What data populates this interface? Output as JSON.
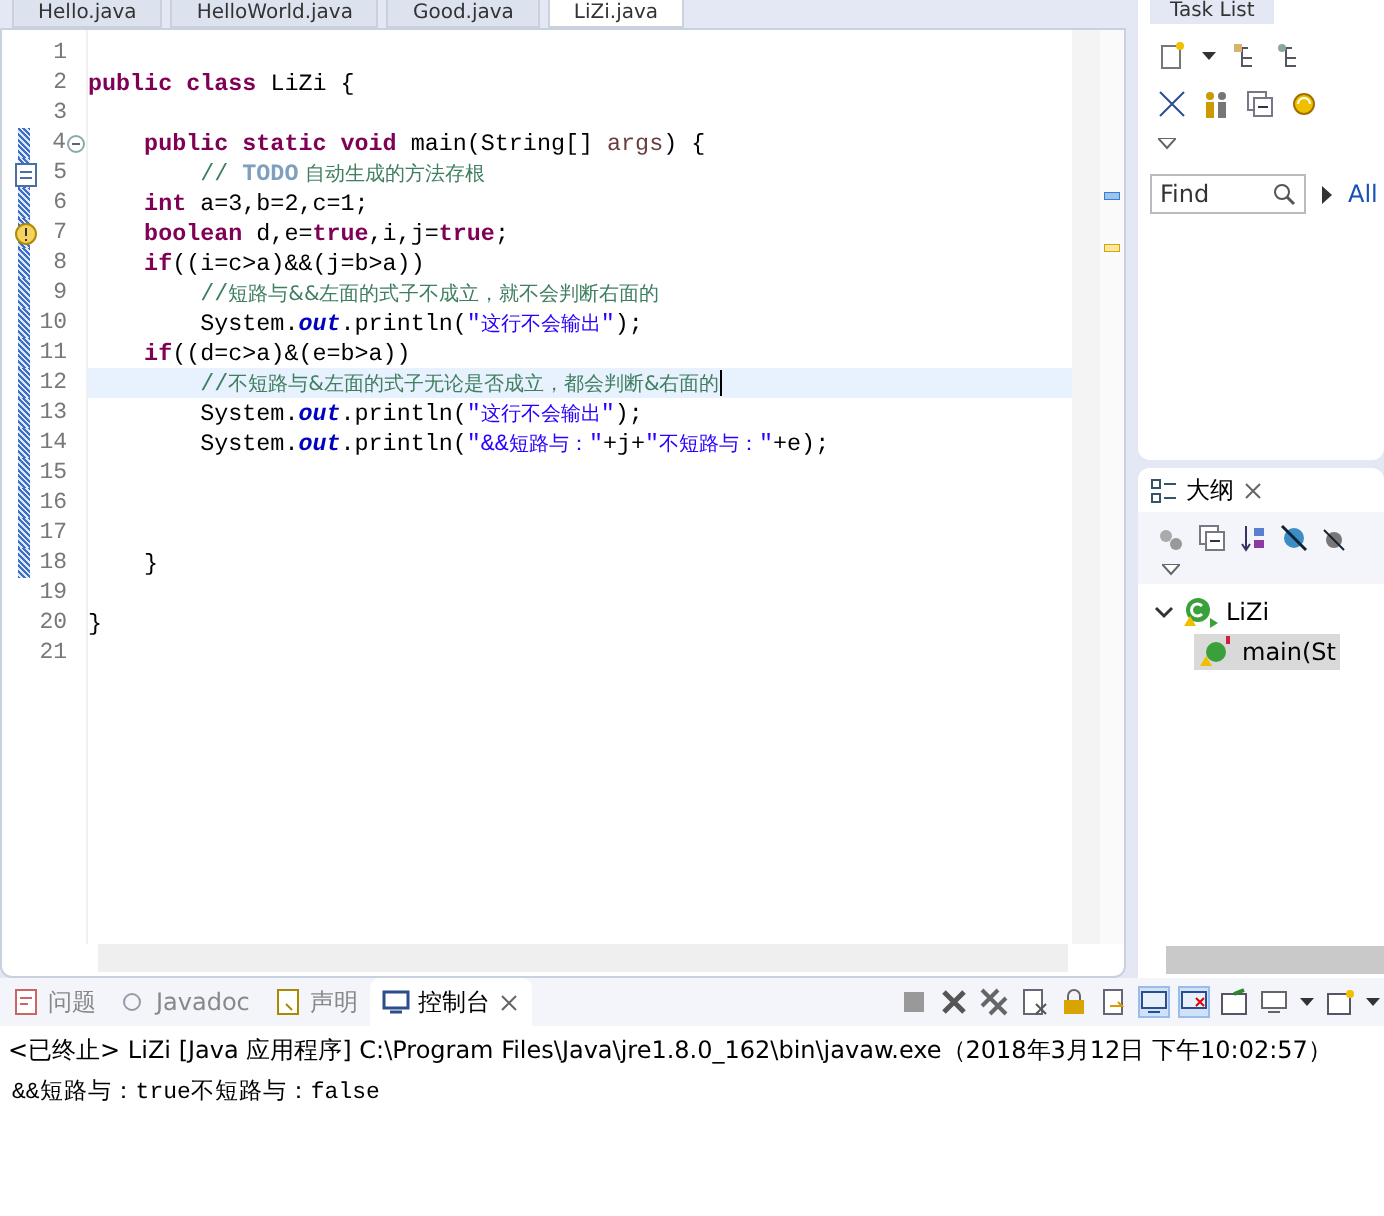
{
  "editor_tabs": [
    {
      "label": "Hello.java",
      "selected": false
    },
    {
      "label": "HelloWorld.java",
      "selected": false
    },
    {
      "label": "Good.java",
      "selected": false
    },
    {
      "label": "LiZi.java",
      "selected": true
    }
  ],
  "code_lines": [
    {
      "number": "1",
      "kind": "plain",
      "current": false,
      "changed": false
    },
    {
      "number": "2",
      "kind": "plain",
      "current": false,
      "changed": false,
      "tokens": [
        {
          "kind": "keyword",
          "text": "public class "
        },
        {
          "kind": "plain",
          "text": "LiZi {"
        }
      ]
    },
    {
      "number": "3",
      "kind": "plain",
      "current": false,
      "changed": false
    },
    {
      "number": "4",
      "kind": "fold",
      "current": false,
      "changed": true,
      "tokens": [
        {
          "kind": "keyword",
          "text": "    public static void "
        },
        {
          "kind": "plain",
          "text": "main(String[] "
        },
        {
          "kind": "variable",
          "text": "args"
        },
        {
          "kind": "plain",
          "text": ") {"
        }
      ]
    },
    {
      "number": "5",
      "kind": "task",
      "current": false,
      "changed": true,
      "tokens": [
        {
          "kind": "comment",
          "text": "        // "
        },
        {
          "kind": "todo",
          "text": "TODO"
        },
        {
          "kind": "comment_cjk",
          "text": " 自动生成的方法存根"
        }
      ]
    },
    {
      "number": "6",
      "kind": "plain",
      "current": false,
      "changed": true,
      "tokens": [
        {
          "kind": "keyword",
          "text": "    int "
        },
        {
          "kind": "plain",
          "text": "a=3,b=2,c=1;"
        }
      ]
    },
    {
      "number": "7",
      "kind": "warning",
      "current": false,
      "changed": true,
      "tokens": [
        {
          "kind": "keyword",
          "text": "    boolean "
        },
        {
          "kind": "plain",
          "text": "d,e="
        },
        {
          "kind": "keyword",
          "text": "true"
        },
        {
          "kind": "plain",
          "text": ",i,j="
        },
        {
          "kind": "keyword",
          "text": "true"
        },
        {
          "kind": "plain",
          "text": ";"
        }
      ]
    },
    {
      "number": "8",
      "kind": "plain",
      "current": false,
      "changed": true,
      "tokens": [
        {
          "kind": "keyword",
          "text": "    if"
        },
        {
          "kind": "plain",
          "text": "((i=c>a)&&(j=b>a))"
        }
      ]
    },
    {
      "number": "9",
      "kind": "plain",
      "current": false,
      "changed": true,
      "tokens": [
        {
          "kind": "comment",
          "text": "        //"
        },
        {
          "kind": "comment_cjk",
          "text": "短路与&&左面的式子不成立，就不会判断右面的"
        }
      ]
    },
    {
      "number": "10",
      "kind": "plain",
      "current": false,
      "changed": true,
      "tokens": [
        {
          "kind": "plain",
          "text": "        System."
        },
        {
          "kind": "field",
          "text": "out"
        },
        {
          "kind": "plain",
          "text": ".println("
        },
        {
          "kind": "string",
          "text": "\""
        },
        {
          "kind": "string_cjk",
          "text": "这行不会输出"
        },
        {
          "kind": "string",
          "text": "\""
        },
        {
          "kind": "plain",
          "text": ");"
        }
      ]
    },
    {
      "number": "11",
      "kind": "plain",
      "current": false,
      "changed": true,
      "tokens": [
        {
          "kind": "keyword",
          "text": "    if"
        },
        {
          "kind": "plain",
          "text": "((d=c>a)&(e=b>a))"
        }
      ]
    },
    {
      "number": "12",
      "kind": "plain",
      "current": true,
      "changed": true,
      "tokens": [
        {
          "kind": "comment",
          "text": "        //"
        },
        {
          "kind": "comment_cjk",
          "text": "不短路与&左面的式子无论是否成立，都会判断&右面的"
        }
      ]
    },
    {
      "number": "13",
      "kind": "plain",
      "current": false,
      "changed": true,
      "tokens": [
        {
          "kind": "plain",
          "text": "        System."
        },
        {
          "kind": "field",
          "text": "out"
        },
        {
          "kind": "plain",
          "text": ".println("
        },
        {
          "kind": "string",
          "text": "\""
        },
        {
          "kind": "string_cjk",
          "text": "这行不会输出"
        },
        {
          "kind": "string",
          "text": "\""
        },
        {
          "kind": "plain",
          "text": ");"
        }
      ]
    },
    {
      "number": "14",
      "kind": "plain",
      "current": false,
      "changed": true,
      "tokens": [
        {
          "kind": "plain",
          "text": "        System."
        },
        {
          "kind": "field",
          "text": "out"
        },
        {
          "kind": "plain",
          "text": ".println("
        },
        {
          "kind": "string",
          "text": "\"&&"
        },
        {
          "kind": "string_cjk",
          "text": "短路与："
        },
        {
          "kind": "string",
          "text": "\""
        },
        {
          "kind": "plain",
          "text": "+j+"
        },
        {
          "kind": "string",
          "text": "\""
        },
        {
          "kind": "string_cjk",
          "text": "不短路与："
        },
        {
          "kind": "string",
          "text": "\""
        },
        {
          "kind": "plain",
          "text": "+e);"
        }
      ]
    },
    {
      "number": "15",
      "kind": "plain",
      "current": false,
      "changed": true
    },
    {
      "number": "16",
      "kind": "plain",
      "current": false,
      "changed": true
    },
    {
      "number": "17",
      "kind": "plain",
      "current": false,
      "changed": true
    },
    {
      "number": "18",
      "kind": "plain",
      "current": false,
      "changed": true,
      "tokens": [
        {
          "kind": "plain",
          "text": "    }"
        }
      ]
    },
    {
      "number": "19",
      "kind": "plain",
      "current": false,
      "changed": false
    },
    {
      "number": "20",
      "kind": "plain",
      "current": false,
      "changed": false,
      "tokens": [
        {
          "kind": "plain",
          "text": "}"
        }
      ]
    },
    {
      "number": "21",
      "kind": "plain",
      "current": false,
      "changed": false
    }
  ],
  "task_list": {
    "tab": "Task List",
    "search": {
      "placeholder": "Find"
    },
    "filter": "All"
  },
  "outline": {
    "tab": "大纲",
    "tree": [
      {
        "label": "LiZi",
        "expanded": true,
        "children": [
          {
            "label": "main(St",
            "selected": true
          }
        ]
      }
    ]
  },
  "console_tabs": [
    {
      "label": "问题",
      "selected": false
    },
    {
      "label": "Javadoc",
      "selected": false
    },
    {
      "label": "声明",
      "selected": false
    },
    {
      "label": "控制台",
      "selected": true
    }
  ],
  "console": {
    "header": "<已终止> LiZi [Java 应用程序] C:\\Program Files\\Java\\jre1.8.0_162\\bin\\javaw.exe（2018年3月12日 下午10:02:57）",
    "output": "&&短路与：true不短路与：false"
  }
}
